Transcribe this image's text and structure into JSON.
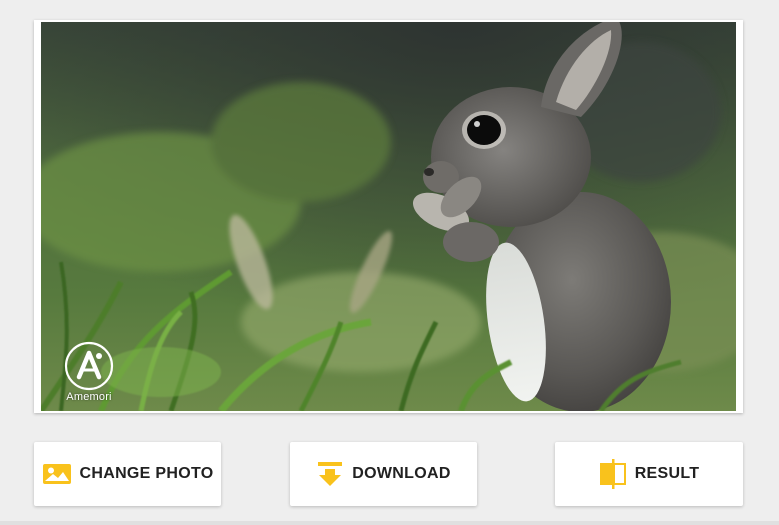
{
  "photo": {
    "alt": "Baby rabbit standing in grass",
    "watermark_label": "Amemori"
  },
  "buttons": {
    "change_photo": "CHANGE PHOTO",
    "download": "DOWNLOAD",
    "result": "RESULT"
  },
  "icons": {
    "change_photo": "image-icon",
    "download": "download-icon",
    "result": "compare-icon"
  },
  "colors": {
    "accent": "#f9c21c",
    "button_text": "#212121",
    "background": "#eeeeee"
  }
}
